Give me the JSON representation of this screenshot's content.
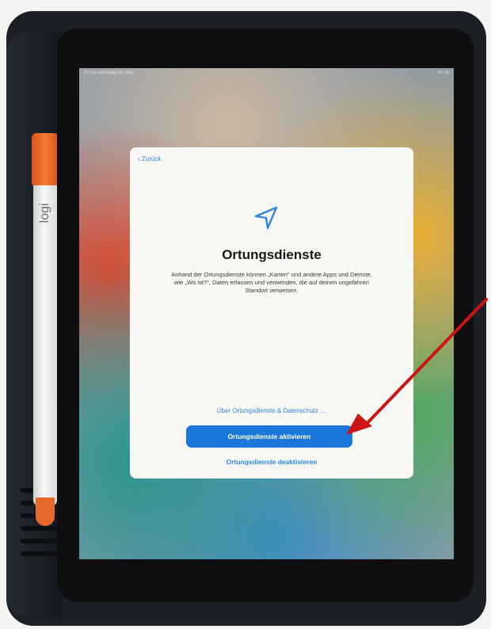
{
  "status_bar": {
    "time": "10:15  Dienstag 28. Dez.",
    "battery": "97 %"
  },
  "accessory": {
    "brand": "logi"
  },
  "dialog": {
    "back_label": "‹ Zurück",
    "icon": "location-arrow-icon",
    "title": "Ortungsdienste",
    "description": "Anhand der Ortungsdienste können „Karten“ und andere Apps und Dienste, wie „Wo ist?“, Daten erfassen und verwenden, die auf deinen ungefähren Standort verweisen.",
    "privacy_link": "Über Ortungsdienste & Datenschutz …",
    "primary_button": "Ortungsdienste aktivieren",
    "secondary_button": "Ortungsdienste deaktivieren"
  },
  "colors": {
    "accent": "#1b77d9",
    "annotation_arrow": "#cc1414"
  }
}
